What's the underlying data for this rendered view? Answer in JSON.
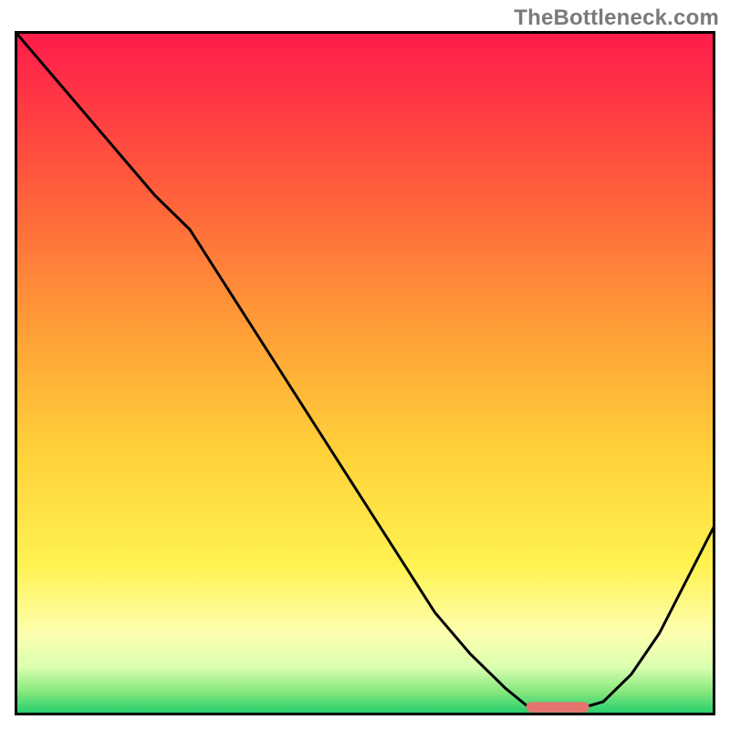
{
  "watermark": {
    "text": "TheBottleneck.com"
  },
  "chart_data": {
    "type": "line",
    "title": "",
    "xlabel": "",
    "ylabel": "",
    "xlim": [
      0,
      100
    ],
    "ylim": [
      0,
      100
    ],
    "grid": false,
    "legend": false,
    "background": {
      "kind": "vertical-gradient",
      "description": "red (top) → orange → yellow → pale yellow → green (bottom)",
      "stops": [
        {
          "offset": 0.0,
          "color": "#ff1a4b"
        },
        {
          "offset": 0.22,
          "color": "#ff5a3c"
        },
        {
          "offset": 0.45,
          "color": "#ffa337"
        },
        {
          "offset": 0.62,
          "color": "#ffd23a"
        },
        {
          "offset": 0.78,
          "color": "#fff250"
        },
        {
          "offset": 0.88,
          "color": "#feffb0"
        },
        {
          "offset": 0.93,
          "color": "#d9ffb0"
        },
        {
          "offset": 0.965,
          "color": "#87e77e"
        },
        {
          "offset": 1.0,
          "color": "#1bce6c"
        }
      ]
    },
    "series": [
      {
        "name": "bottleneck-curve",
        "color": "#000000",
        "x": [
          0,
          5,
          10,
          15,
          20,
          25,
          30,
          35,
          40,
          45,
          50,
          55,
          60,
          65,
          70,
          73,
          76,
          80,
          84,
          88,
          92,
          96,
          100
        ],
        "y": [
          100,
          94,
          88,
          82,
          76,
          71,
          63,
          55,
          47,
          39,
          31,
          23,
          15,
          9,
          4,
          1.5,
          0.8,
          0.8,
          2,
          6,
          12,
          20,
          28
        ]
      }
    ],
    "marker": {
      "name": "optimal-range",
      "shape": "rounded-rect",
      "color": "#e6736e",
      "x_range": [
        73,
        82
      ],
      "y": 1.2,
      "height_pct": 1.5
    },
    "frame": {
      "color": "#000000",
      "width": 3
    }
  }
}
